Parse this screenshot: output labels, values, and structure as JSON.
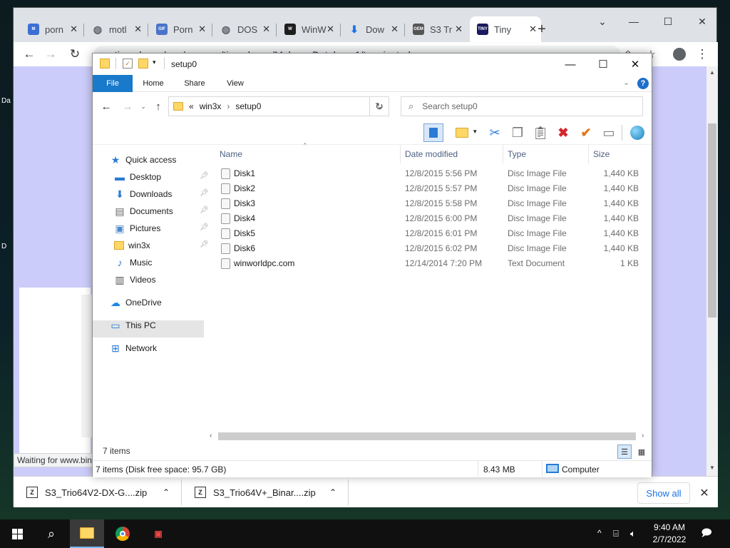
{
  "desktop": {
    "icon_labels": [
      "Da",
      "D"
    ]
  },
  "browser": {
    "tabs": [
      {
        "label": "porn",
        "favicon": "myg-icon",
        "color": "#3b6fd6"
      },
      {
        "label": "motl",
        "favicon": "globe-icon",
        "color": "#5f6368"
      },
      {
        "label": "Porn",
        "favicon": "gif-icon",
        "color": "#4a74c9"
      },
      {
        "label": "DOS",
        "favicon": "globe-icon",
        "color": "#5f6368"
      },
      {
        "label": "WinW",
        "favicon": "w-icon",
        "color": "#1e1e1e"
      },
      {
        "label": "Dow",
        "favicon": "download-icon",
        "color": "#1a73e8"
      },
      {
        "label": "S3 Tr",
        "favicon": "oem-icon",
        "color": "#555555"
      },
      {
        "label": "Tiny",
        "favicon": "tinyurl-icon",
        "color": "#1a1a5e",
        "active": true
      }
    ],
    "favicon_texts": {
      "myg": "M",
      "gif": "GIF",
      "w": "W",
      "oem": "OEM",
      "tinyurl": "TINY"
    },
    "url": "tinyurl.com/app/nospam/tinyurl.com/MalwareDatabase1/terminated",
    "status_text": "Waiting for www.bing.com...",
    "downloads": [
      {
        "name": "S3_Trio64V2-DX-G....zip"
      },
      {
        "name": "S3_Trio64V+_Binar....zip"
      }
    ],
    "show_all_label": "Show all"
  },
  "explorer": {
    "title": "setup0",
    "ribbon_tabs": [
      "File",
      "Home",
      "Share",
      "View"
    ],
    "address": {
      "overflow": "«",
      "parts": [
        "win3x",
        "setup0"
      ]
    },
    "search_placeholder": "Search setup0",
    "nav": [
      {
        "label": "Quick access",
        "icon": "star-icon",
        "indent": 0
      },
      {
        "label": "Desktop",
        "icon": "desktop-icon",
        "indent": 1,
        "pinned": true
      },
      {
        "label": "Downloads",
        "icon": "download-arrow-icon",
        "indent": 1,
        "pinned": true
      },
      {
        "label": "Documents",
        "icon": "documents-icon",
        "indent": 1,
        "pinned": true
      },
      {
        "label": "Pictures",
        "icon": "pictures-icon",
        "indent": 1,
        "pinned": true
      },
      {
        "label": "win3x",
        "icon": "folder-icon",
        "indent": 1,
        "pinned": true
      },
      {
        "label": "Music",
        "icon": "music-icon",
        "indent": 1
      },
      {
        "label": "Videos",
        "icon": "videos-icon",
        "indent": 1
      },
      {
        "label": "OneDrive",
        "icon": "cloud-icon",
        "indent": 0
      },
      {
        "label": "This PC",
        "icon": "computer-icon",
        "indent": 0,
        "selected": true
      },
      {
        "label": "Network",
        "icon": "network-icon",
        "indent": 0
      }
    ],
    "columns": [
      "Name",
      "Date modified",
      "Type",
      "Size"
    ],
    "files": [
      {
        "name": "Disk1",
        "date": "12/8/2015 5:56 PM",
        "type": "Disc Image File",
        "size": "1,440 KB"
      },
      {
        "name": "Disk2",
        "date": "12/8/2015 5:57 PM",
        "type": "Disc Image File",
        "size": "1,440 KB"
      },
      {
        "name": "Disk3",
        "date": "12/8/2015 5:58 PM",
        "type": "Disc Image File",
        "size": "1,440 KB"
      },
      {
        "name": "Disk4",
        "date": "12/8/2015 6:00 PM",
        "type": "Disc Image File",
        "size": "1,440 KB"
      },
      {
        "name": "Disk5",
        "date": "12/8/2015 6:01 PM",
        "type": "Disc Image File",
        "size": "1,440 KB"
      },
      {
        "name": "Disk6",
        "date": "12/8/2015 6:02 PM",
        "type": "Disc Image File",
        "size": "1,440 KB"
      },
      {
        "name": "winworldpc.com",
        "date": "12/14/2014 7:20 PM",
        "type": "Text Document",
        "size": "1 KB"
      }
    ],
    "item_count": "7 items",
    "status": {
      "left": "7 items (Disk free space: 95.7 GB)",
      "mid": "8.43 MB",
      "right": "Computer"
    }
  },
  "taskbar": {
    "time": "9:40 AM",
    "date": "2/7/2022"
  }
}
